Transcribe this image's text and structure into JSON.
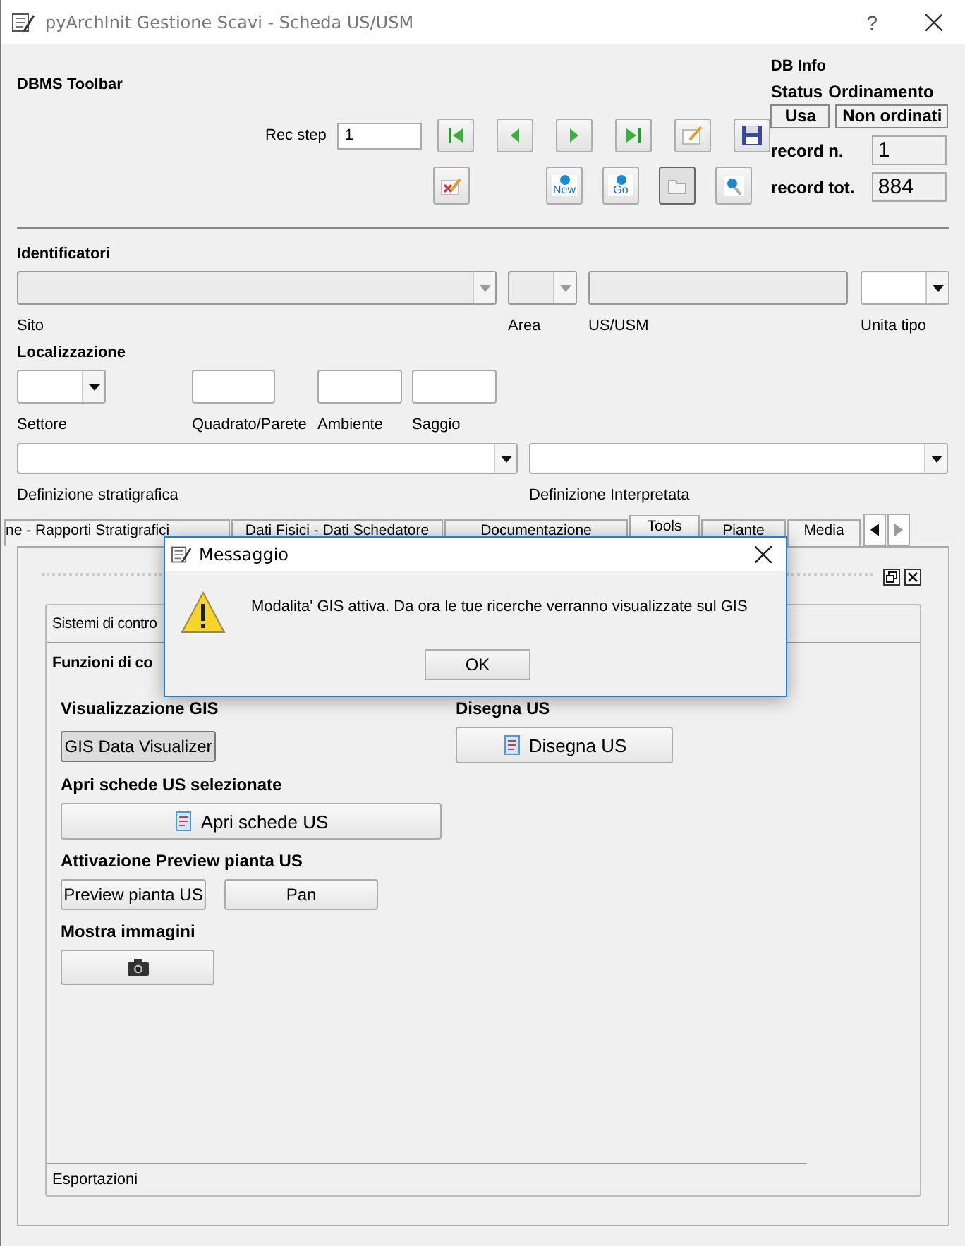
{
  "window": {
    "title": "pyArchInit Gestione Scavi - Scheda US/USM",
    "help": "?"
  },
  "toolbar": {
    "title": "DBMS Toolbar",
    "rec_step_label": "Rec step",
    "rec_step_value": "1",
    "row1": [
      {
        "kind": "first"
      },
      {
        "kind": "prev"
      },
      {
        "kind": "next"
      },
      {
        "kind": "last"
      },
      {
        "kind": "edit"
      },
      {
        "kind": "save"
      }
    ],
    "row2": [
      {
        "kind": "delete"
      },
      {
        "kind": "blank"
      },
      {
        "kind": "new",
        "label": "New"
      },
      {
        "kind": "go",
        "label": "Go"
      },
      {
        "kind": "folder",
        "pressed": true
      },
      {
        "kind": "search"
      }
    ]
  },
  "db_info": {
    "title": "DB Info",
    "status_label": "Status",
    "order_label": "Ordinamento",
    "status_value": "Usa",
    "order_value": "Non ordinati",
    "record_n_label": "record n.",
    "record_n": "1",
    "record_tot_label": "record tot.",
    "record_tot": "884"
  },
  "identificatori": {
    "title": "Identificatori",
    "fields": [
      {
        "label": "Sito",
        "kind": "combo",
        "disabled": true
      },
      {
        "label": "Area",
        "kind": "combo",
        "disabled": true
      },
      {
        "label": "US/USM",
        "kind": "text",
        "disabled": true
      },
      {
        "label": "Unita tipo",
        "kind": "combo",
        "disabled": false
      }
    ]
  },
  "localizzazione": {
    "title": "Localizzazione",
    "fields": [
      {
        "label": "Settore",
        "kind": "combo",
        "disabled": false
      },
      {
        "label": "Quadrato/Parete",
        "kind": "text",
        "disabled": false
      },
      {
        "label": "Ambiente",
        "kind": "text",
        "disabled": false
      },
      {
        "label": "Saggio",
        "kind": "text",
        "disabled": false
      }
    ]
  },
  "definizioni": [
    {
      "label": "Definizione stratigrafica"
    },
    {
      "label": "Definizione Interpretata"
    }
  ],
  "tabs": [
    {
      "label": "ne - Rapporti Stratigrafici",
      "selected": false
    },
    {
      "label": "Dati Fisici - Dati Schedatore",
      "selected": false
    },
    {
      "label": "Documentazione",
      "selected": false
    },
    {
      "label": "Tools",
      "selected": true
    },
    {
      "label": "Piante",
      "selected": false
    },
    {
      "label": "Media",
      "selected": false
    }
  ],
  "toolbox": {
    "items": [
      {
        "label": "Sistemi di contro",
        "selected": false
      },
      {
        "label": "Funzioni di co",
        "selected": true
      }
    ],
    "last_item": {
      "label": "Esportazioni"
    }
  },
  "sections": {
    "gis": {
      "title": "Visualizzazione GIS",
      "button": "GIS Data Visualizer",
      "pressed": true
    },
    "disegna": {
      "title": "Disegna US",
      "button": "Disegna US"
    },
    "apri": {
      "title": "Apri schede US selezionate",
      "button": "Apri schede US"
    },
    "preview": {
      "title": "Attivazione Preview pianta US",
      "buttons": [
        "Preview pianta US",
        "Pan"
      ]
    },
    "immagini": {
      "title": "Mostra immagini"
    }
  },
  "dialog": {
    "title": "Messaggio",
    "message": "Modalita' GIS attiva. Da ora le tue ricerche verranno visualizzate sul GIS",
    "ok": "OK"
  }
}
